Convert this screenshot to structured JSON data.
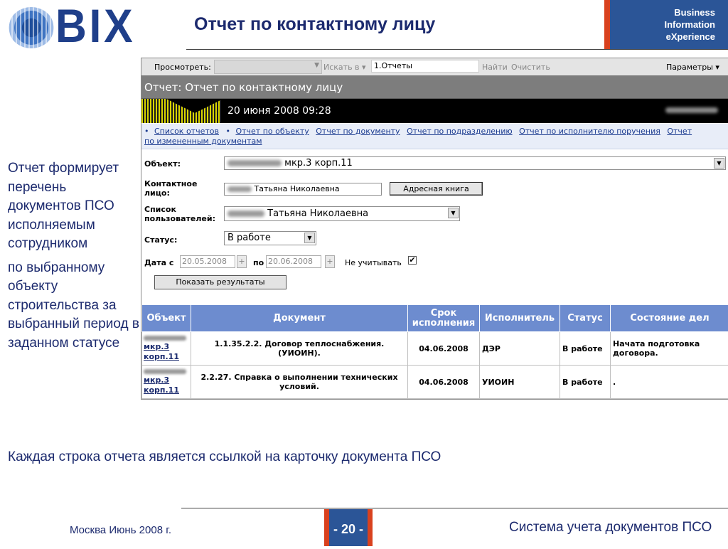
{
  "header": {
    "logo_text": "BIX",
    "title": "Отчет по контактному лицу",
    "brand_lines": [
      "Business",
      "Information",
      "eXperience"
    ],
    "accent_color": "#2b5597",
    "stripe_color": "#d9411e"
  },
  "description": {
    "paragraph1": "Отчет формирует перечень документов ПСО исполняемым сотрудником",
    "paragraph2": "по выбранному объекту строительства за выбранный период в заданном статусе"
  },
  "note": "Каждая строка отчета является ссылкой на карточку документа ПСО",
  "app": {
    "toolbar": {
      "view_label": "Просмотреть:",
      "search_in_label": "Искать в",
      "search_value": "1.Отчеты",
      "find_label": "Найти",
      "clear_label": "Очистить",
      "params_label": "Параметры"
    },
    "report_title": "Отчет: Отчет по контактному лицу",
    "date": "20 июня 2008 09:28",
    "links": [
      "Список отчетов",
      "Отчет по объекту",
      "Отчет по документу",
      "Отчет по подразделению",
      "Отчет по исполнителю поручения",
      "Отчет"
    ],
    "links_row2": "по измененным документам",
    "form": {
      "object_label": "Объект:",
      "object_value": "мкр.3 корп.11",
      "contact_label_1": "Контактное",
      "contact_label_2": "лицо:",
      "contact_value": "Татьяна Николаевна",
      "address_book_button": "Адресная книга",
      "users_label_1": "Список",
      "users_label_2": "пользователей:",
      "users_value": "Татьяна Николаевна",
      "status_label": "Статус:",
      "status_value": "В работе",
      "date_from_label": "Дата с",
      "date_from": "20.05.2008",
      "date_to_label": "по",
      "date_to": "20.06.2008",
      "ignore_label": "Не учитывать",
      "ignore_checked": true,
      "show_results_button": "Показать результаты"
    },
    "table": {
      "headers": [
        "Объект",
        "Документ",
        "Срок исполнения",
        "Исполнитель",
        "Статус",
        "Состояние дел"
      ],
      "rows": [
        {
          "object_line1": "мкр.3",
          "object_line2": "корп.11",
          "document": "1.1.35.2.2. Договор теплоснабжения. (УИОИН).",
          "due_date": "04.06.2008",
          "executor": "ДЭР",
          "status": "В работе",
          "state": "Начата подготовка договора."
        },
        {
          "object_line1": "мкр.3",
          "object_line2": "корп.11",
          "document": "2.2.27. Справка о выполнении технических условий.",
          "due_date": "04.06.2008",
          "executor": "УИОИН",
          "status": "В работе",
          "state": "."
        }
      ]
    }
  },
  "footer": {
    "left": "Москва  Июнь  2008 г.",
    "page": "- 20 -",
    "right": "Система учета документов ПСО"
  }
}
